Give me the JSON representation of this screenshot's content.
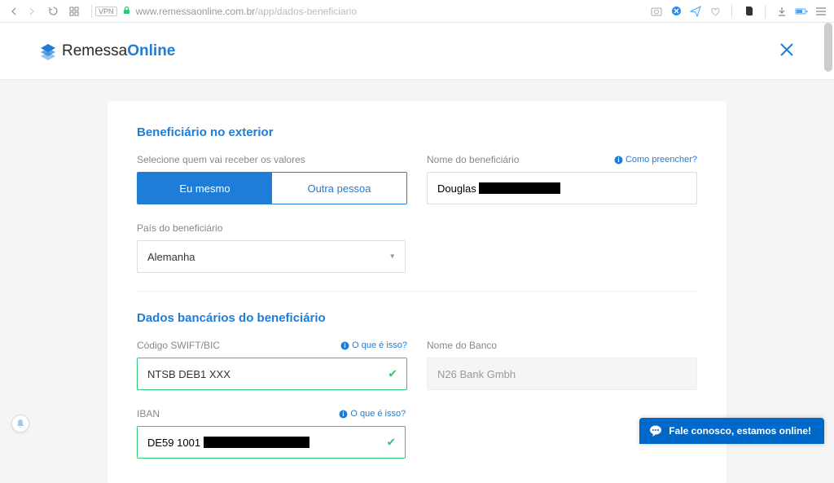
{
  "browser": {
    "url_host": "www.remessaonline.com.br",
    "url_path": "/app/dados-beneficiario",
    "vpn": "VPN"
  },
  "header": {
    "brand_first": "Remessa",
    "brand_second": "Online"
  },
  "section_beneficiary": {
    "title": "Beneficiário no exterior",
    "select_label": "Selecione quem vai receber os valores",
    "seg_self": "Eu mesmo",
    "seg_other": "Outra pessoa",
    "name_label": "Nome do beneficiário",
    "name_value": "Douglas",
    "name_help": "Como preencher?",
    "country_label": "País do beneficiário",
    "country_value": "Alemanha"
  },
  "section_bank": {
    "title": "Dados bancários do beneficiário",
    "swift_label": "Código SWIFT/BIC",
    "swift_help": "O que é isso?",
    "swift_value": "NTSB DEB1 XXX",
    "bank_label": "Nome do Banco",
    "bank_value": "N26 Bank Gmbh",
    "iban_label": "IBAN",
    "iban_help": "O que é isso?",
    "iban_value": "DE59 1001"
  },
  "chat": {
    "label": "Fale conosco, estamos online!"
  }
}
